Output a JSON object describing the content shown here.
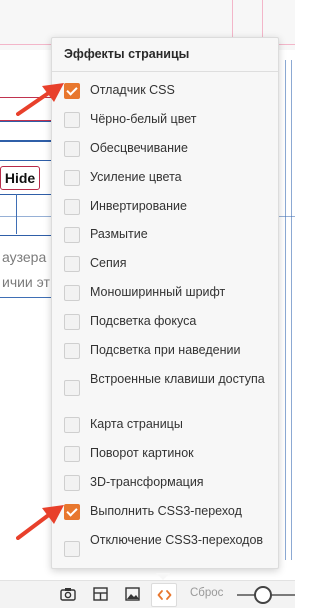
{
  "background_page": {
    "hide_button": "Hide",
    "text_line_1": "аузера",
    "text_line_2": "ичии эт"
  },
  "panel": {
    "title": "Эффекты страницы",
    "items": [
      {
        "label": "Отладчик CSS",
        "checked": true
      },
      {
        "label": "Чёрно-белый цвет",
        "checked": false
      },
      {
        "label": "Обесцвечивание",
        "checked": false
      },
      {
        "label": "Усиление цвета",
        "checked": false
      },
      {
        "label": "Инвертирование",
        "checked": false
      },
      {
        "label": "Размытие",
        "checked": false
      },
      {
        "label": "Сепия",
        "checked": false
      },
      {
        "label": "Моноширинный шрифт",
        "checked": false
      },
      {
        "label": "Подсветка фокуса",
        "checked": false
      },
      {
        "label": "Подсветка при наведении",
        "checked": false
      },
      {
        "label": "Встроенные клавиши доступа",
        "checked": false
      },
      {
        "label": "Карта страницы",
        "checked": false
      },
      {
        "label": "Поворот картинок",
        "checked": false
      },
      {
        "label": "3D-трансформация",
        "checked": false
      },
      {
        "label": "Выполнить CSS3-переход",
        "checked": true
      },
      {
        "label": "Отключение CSS3-переходов",
        "checked": false
      }
    ]
  },
  "toolbar": {
    "reset_label": "Сброс",
    "buttons": [
      "camera-icon",
      "panels-icon",
      "image-icon",
      "code-icon"
    ],
    "active_button": "code-icon"
  },
  "colors": {
    "accent": "#e8772e",
    "arrow": "#e8402b"
  }
}
